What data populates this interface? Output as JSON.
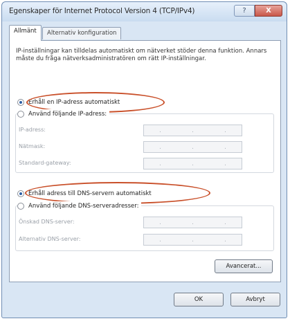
{
  "window": {
    "title": "Egenskaper för Internet Protocol Version 4 (TCP/IPv4)",
    "help_glyph": "?",
    "close_glyph": "X"
  },
  "tabs": [
    {
      "label": "Allmänt",
      "active": true
    },
    {
      "label": "Alternativ konfiguration",
      "active": false
    }
  ],
  "description": "IP-inställningar kan tilldelas automatiskt om nätverket stöder denna funktion. Annars måste du fråga nätverksadministratören om rätt IP-inställningar.",
  "ip_section": {
    "auto_label": "Erhåll en IP-adress automatiskt",
    "auto_checked": true,
    "manual_label": "Använd följande IP-adress:",
    "manual_checked": false,
    "fields": [
      {
        "label": "IP-adress:"
      },
      {
        "label": "Nätmask:"
      },
      {
        "label": "Standard-gateway:"
      }
    ]
  },
  "dns_section": {
    "auto_label": "Erhåll adress till DNS-servern automatiskt",
    "auto_checked": true,
    "manual_label": "Använd följande DNS-serveradresser:",
    "manual_checked": false,
    "fields": [
      {
        "label": "Önskad DNS-server:"
      },
      {
        "label": "Alternativ DNS-server:"
      }
    ]
  },
  "ip_dots": ".",
  "buttons": {
    "advanced": "Avancerat...",
    "ok": "OK",
    "cancel": "Avbryt"
  },
  "colors": {
    "highlight": "#c9502a",
    "radio_checked": "#2c5fa5"
  }
}
